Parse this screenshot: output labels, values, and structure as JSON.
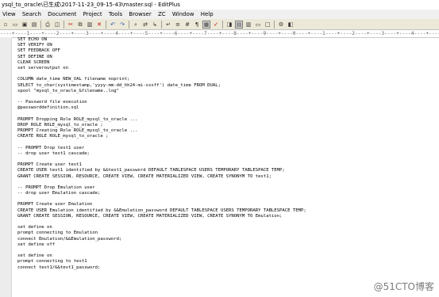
{
  "window": {
    "title": "ysql_to_oracle\\已生成\\2017-11-23_09-15-43\\master.sql - EditPlus"
  },
  "menu": {
    "items": [
      "View",
      "Search",
      "Document",
      "Project",
      "Tools",
      "Browser",
      "ZC",
      "Window",
      "Help"
    ]
  },
  "ruler": {
    "text": "----+----1----+----2----+----3----+----4----+----5----+----6----+----7----+----8----+----9----+----0----+----1----+----2----+----3----+----4----+----5----+"
  },
  "code": {
    "lines": [
      "SET ECHO ON",
      "SET VERIFY ON",
      "SET FEEDBACK OFF",
      "SET DEFINE ON",
      "CLEAR SCREEN",
      "set serveroutput on",
      "",
      "COLUMN date_time NEW_VAL filename noprint;",
      "SELECT to_char(systimestamp,'yyyy-mm-dd_hh24-mi-ssxff') date_time FROM DUAL;",
      "spool \"mysql_to_oracle_&filename..log\"",
      "",
      "-- Password file execution",
      "@passworddefinition.sql",
      "",
      "PROMPT Dropping Role ROLE_mysql_to_oracle ...",
      "DROP ROLE ROLE_mysql_to_oracle ;",
      "PROMPT Creating Role ROLE_mysql_to_oracle ...",
      "CREATE ROLE ROLE_mysql_to_oracle ;",
      "",
      "-- PROMPT Drop test1 user",
      "-- drop user test1 cascade;",
      "",
      "PROMPT Create user test1",
      "CREATE USER test1 identified by &&test1_password DEFAULT TABLESPACE USERS TEMPORARY TABLESPACE TEMP;",
      "GRANT CREATE SESSION, RESOURCE, CREATE VIEW, CREATE MATERIALIZED VIEW, CREATE SYNONYM TO test1;",
      "",
      "-- PROMPT Drop Emulation user",
      "-- drop user Emulation cascade;",
      "",
      "PROMPT Create user Emulation",
      "CREATE USER Emulation identified by &&Emulation_password DEFAULT TABLESPACE USERS TEMPORARY TABLESPACE TEMP;",
      "GRANT CREATE SESSION, RESOURCE, CREATE VIEW, CREATE MATERIALIZED VIEW, CREATE SYNONYM TO Emulation;",
      "",
      "set define on",
      "prompt connecting to Emulation",
      "connect Emulation/&&Emulation_password;",
      "set define off",
      "",
      "set define on",
      "prompt connecting to test1",
      "connect test1/&&test1_password;"
    ]
  },
  "watermark": {
    "text": "@51CTO博客"
  }
}
